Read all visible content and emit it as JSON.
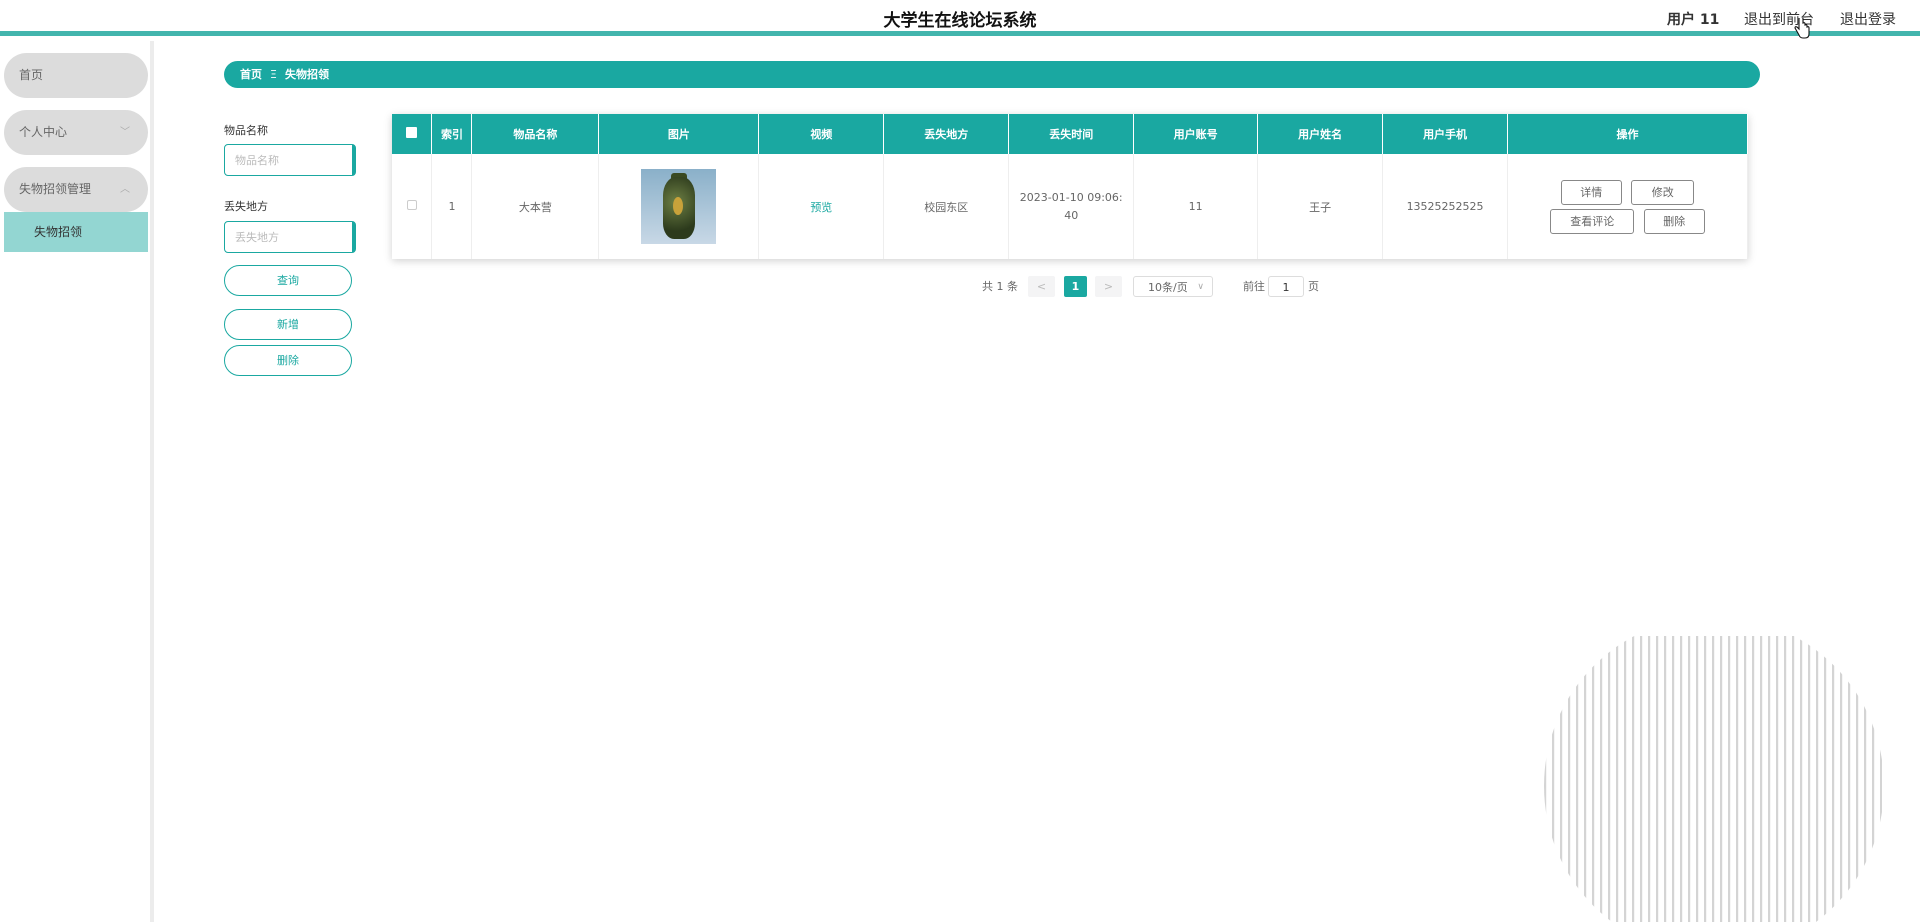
{
  "header": {
    "title": "大学生在线论坛系统",
    "user": "用户 11",
    "to_front": "退出到前台",
    "logout": "退出登录"
  },
  "sidebar": {
    "items": [
      {
        "label": "首页"
      },
      {
        "label": "个人中心"
      },
      {
        "label": "失物招领管理"
      }
    ],
    "sub_item": "失物招领"
  },
  "breadcrumb": {
    "home": "首页",
    "separator": "Ξ",
    "current": "失物招领"
  },
  "search": {
    "name_label": "物品名称",
    "name_placeholder": "物品名称",
    "place_label": "丢失地方",
    "place_placeholder": "丢失地方",
    "query_button": "查询",
    "add_button": "新增",
    "delete_button": "删除"
  },
  "table": {
    "headers": [
      "索引",
      "物品名称",
      "图片",
      "视频",
      "丢失地方",
      "丢失时间",
      "用户账号",
      "用户姓名",
      "用户手机",
      "操作"
    ],
    "rows": [
      {
        "index": "1",
        "name": "大本营",
        "video": "预览",
        "place": "校园东区",
        "time": "2023-01-10 09:06:40",
        "account": "11",
        "username": "王子",
        "phone": "13525252525"
      }
    ],
    "actions": {
      "detail": "详情",
      "edit": "修改",
      "comments": "查看评论",
      "delete": "删除"
    }
  },
  "pagination": {
    "total": "共 1 条",
    "prev": "<",
    "next": ">",
    "current_page": "1",
    "page_size": "10条/页",
    "goto_label": "前往",
    "goto_value": "1",
    "goto_suffix": "页"
  },
  "colors": {
    "accent": "#1aa8a1",
    "topbar_line": "#43b5ad",
    "submenu_bg": "#93d6d2",
    "menu_bg": "#dcdcdc"
  },
  "icons": {
    "cursor": "hand-pointer-icon",
    "menu_chevron_down": "chevron-down-icon",
    "menu_chevron_up": "chevron-up-icon",
    "page_size_caret": "chevron-down-icon"
  }
}
